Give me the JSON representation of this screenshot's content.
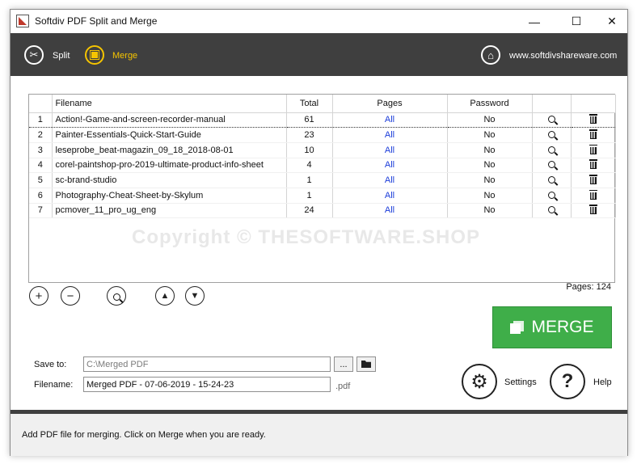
{
  "window": {
    "title": "Softdiv PDF Split and Merge"
  },
  "toolbar": {
    "split_label": "Split",
    "merge_label": "Merge",
    "website": "www.softdivshareware.com",
    "accent": "#f5c400"
  },
  "table": {
    "headers": {
      "num": "",
      "filename": "Filename",
      "total": "Total",
      "pages": "Pages",
      "password": "Password"
    },
    "rows": [
      {
        "num": "1",
        "filename": "Action!-Game-and-screen-recorder-manual",
        "total": "61",
        "pages": "All",
        "password": "No"
      },
      {
        "num": "2",
        "filename": "Painter-Essentials-Quick-Start-Guide",
        "total": "23",
        "pages": "All",
        "password": "No"
      },
      {
        "num": "3",
        "filename": "leseprobe_beat-magazin_09_18_2018-08-01",
        "total": "10",
        "pages": "All",
        "password": "No"
      },
      {
        "num": "4",
        "filename": "corel-paintshop-pro-2019-ultimate-product-info-sheet",
        "total": "4",
        "pages": "All",
        "password": "No"
      },
      {
        "num": "5",
        "filename": "sc-brand-studio",
        "total": "1",
        "pages": "All",
        "password": "No"
      },
      {
        "num": "6",
        "filename": "Photography-Cheat-Sheet-by-Skylum",
        "total": "1",
        "pages": "All",
        "password": "No"
      },
      {
        "num": "7",
        "filename": "pcmover_11_pro_ug_eng",
        "total": "24",
        "pages": "All",
        "password": "No"
      }
    ]
  },
  "watermark": "Copyright © THESOFTWARE.SHOP",
  "pages_total": "Pages: 124",
  "merge_button": {
    "label": "MERGE",
    "color": "#3fae49"
  },
  "save_to": {
    "label": "Save to:",
    "value": "C:\\Merged PDF",
    "browse": "..."
  },
  "filename_field": {
    "label": "Filename:",
    "value": "Merged PDF - 07-06-2019 - 15-24-23",
    "ext": ".pdf"
  },
  "settings_label": "Settings",
  "help_label": "Help",
  "status": "Add PDF file for merging. Click on Merge when you are ready."
}
